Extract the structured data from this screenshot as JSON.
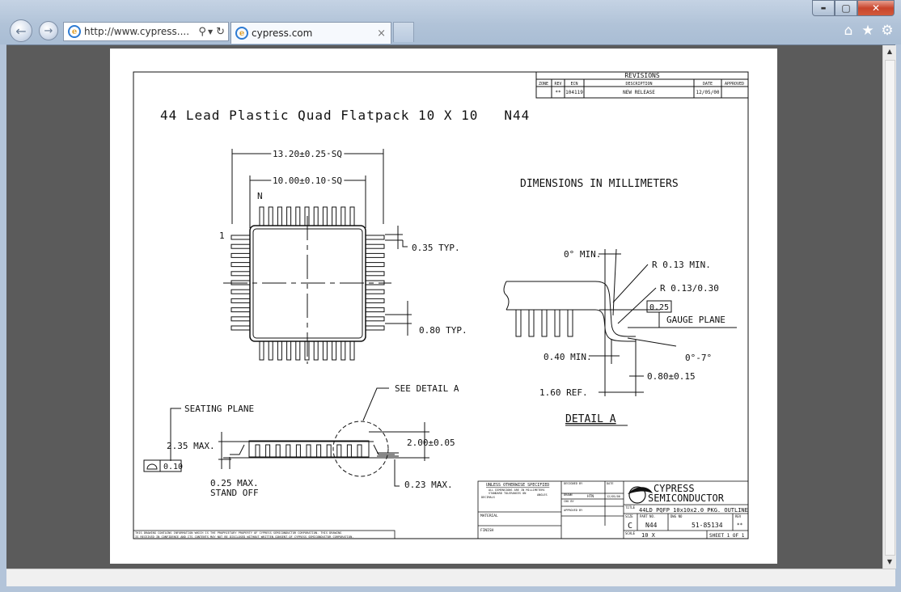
{
  "browser": {
    "address_url": "http://www.cypress....",
    "tab_title": "cypress.com",
    "tab_close": "×",
    "controls": {
      "minimize": "▬",
      "maximize": "▢",
      "close": "✕"
    }
  },
  "drawing": {
    "title": "44 Lead Plastic Quad Flatpack 10 X 10   N44",
    "dimensions_note": "DIMENSIONS IN MILLIMETERS",
    "top_view": {
      "outer_dim": "13.20±0.25 SQ",
      "inner_dim": "10.00±0.10 SQ",
      "pin_n": "N",
      "pin_1": "1",
      "lead_width": "0.35 TYP.",
      "lead_pitch": "0.80 TYP."
    },
    "side_view": {
      "seating_plane": "SEATING PLANE",
      "see_detail": "SEE DETAIL A",
      "max_height": "2.35 MAX.",
      "body_height": "2.00±0.05",
      "flatness": "0.10",
      "standoff": "0.25 MAX.",
      "standoff2": "STAND OFF",
      "lead_thick": "0.23 MAX."
    },
    "detail_a": {
      "label": "DETAIL A",
      "angle_min": "0° MIN.",
      "radius_min": "R 0.13 MIN.",
      "radius_range": "R 0.13/0.30",
      "gauge_value": "0.25",
      "gauge_plane": "GAUGE PLANE",
      "angle_range": "0°-7°",
      "foot_min": "0.40 MIN.",
      "foot_len": "0.80±0.15",
      "ref_len": "1.60 REF."
    },
    "revisions": {
      "header": "REVISIONS",
      "columns": [
        "ZONE",
        "REV",
        "ECN",
        "DESCRIPTION",
        "DATE",
        "APPROVED"
      ],
      "row": [
        "",
        "**",
        "104119",
        "NEW RELEASE",
        "12/05/00",
        ""
      ]
    },
    "title_block": {
      "unless": "UNLESS OTHERWISE SPECIFIED",
      "note1": "ALL DIMENSIONS ARE IN MILLIMETERS",
      "note2": "STANDARD TOLERANCES ON",
      "decimals": "DECIMALS",
      "angles": "ANGLES",
      "material": "MATERIAL",
      "finish": "FINISH",
      "designed_by": "DESIGNED BY",
      "drawn": "DRAWN",
      "drawn_by": "HTN",
      "drawn_date": "12/05/00",
      "chk_by": "CHK BY",
      "approved_by": "APPROVED BY",
      "date": "DATE",
      "company1": "CYPRESS",
      "company2": "SEMICONDUCTOR",
      "title_label": "TITLE",
      "title_value": "44LD PQFP 10x10x2.0 PKG. OUTLINE",
      "size_label": "SIZE",
      "size": "C",
      "part_label": "PART NO.",
      "part_no": "N44",
      "dwg_label": "DWG NO",
      "dwg_no": "51-85134",
      "rev_label": "REV",
      "rev": "**",
      "scale_label": "SCALE",
      "scale": "10 X",
      "sheet": "SHEET 1 OF 1"
    },
    "proprietary_1": "THIS DRAWING CONTAINS INFORMATION WHICH IS THE PROPRIETARY PROPERTY OF CYPRESS SEMICONDUCTOR CORPORATION. THIS DRAWING",
    "proprietary_2": "IS RECEIVED IN CONFIDENCE AND ITS CONTENTS MAY NOT BE DISCLOSED WITHOUT WRITTEN CONSENT OF CYPRESS SEMICONDUCTOR CORPORATION."
  }
}
